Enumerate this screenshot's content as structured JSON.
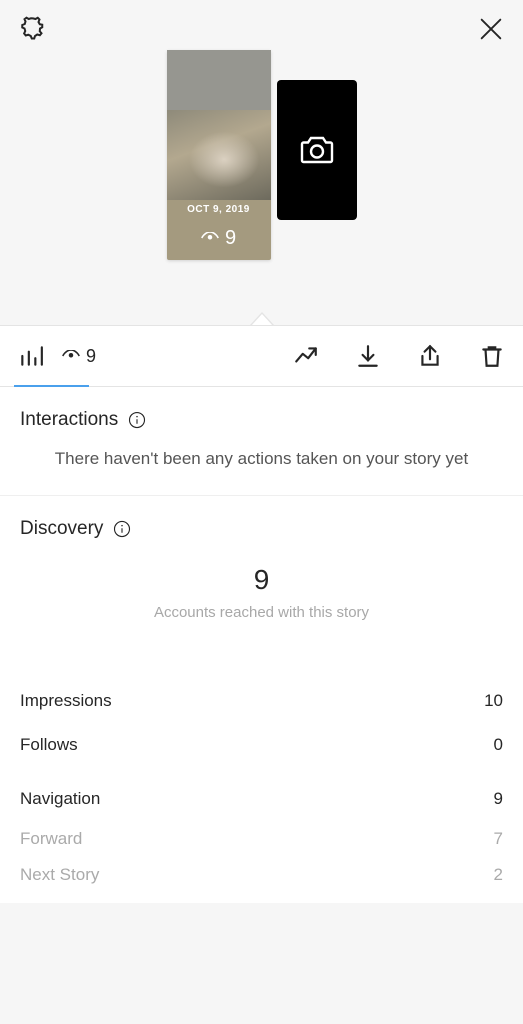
{
  "story": {
    "date_label": "OCT 9, 2019",
    "view_count": "9"
  },
  "toolbar": {
    "view_count": "9"
  },
  "interactions": {
    "title": "Interactions",
    "empty_message": "There haven't been any actions taken on your story yet"
  },
  "discovery": {
    "title": "Discovery",
    "reach_count": "9",
    "reach_label": "Accounts reached with this story"
  },
  "metrics": {
    "impressions_label": "Impressions",
    "impressions_value": "10",
    "follows_label": "Follows",
    "follows_value": "0",
    "navigation_label": "Navigation",
    "navigation_value": "9",
    "forward_label": "Forward",
    "forward_value": "7",
    "next_story_label": "Next Story",
    "next_story_value": "2"
  }
}
